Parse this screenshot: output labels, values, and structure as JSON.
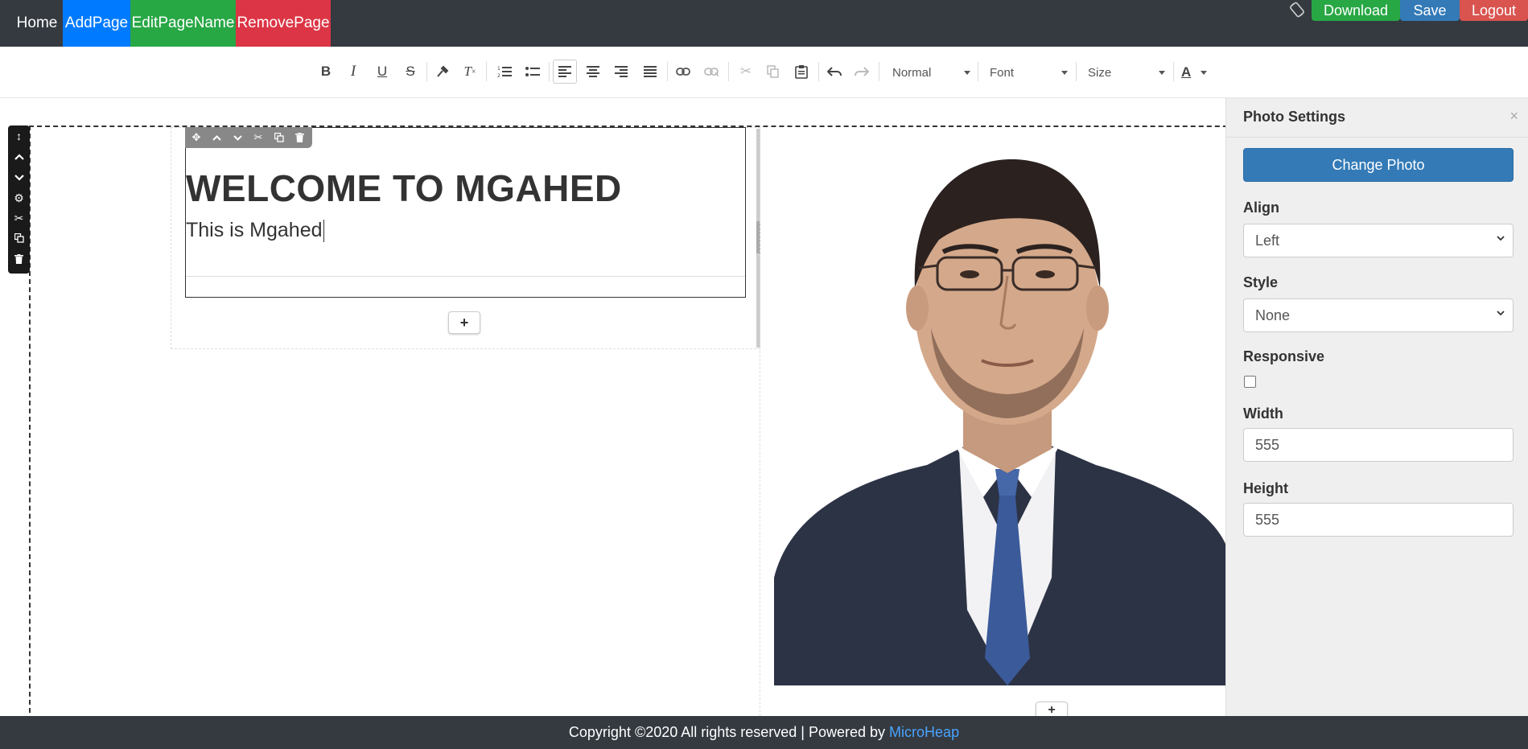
{
  "nav": {
    "home": "Home",
    "add_page": "AddPage",
    "edit_page_name": "EditPageName",
    "remove_page": "RemovePage",
    "download": "Download",
    "save": "Save",
    "logout": "Logout"
  },
  "toolbar": {
    "format_select": "Normal",
    "font_select": "Font",
    "size_select": "Size",
    "text_color": "A",
    "icons": [
      "bold-icon",
      "italic-icon",
      "underline-icon",
      "strike-icon",
      "format-painter-icon",
      "clear-format-icon",
      "ordered-list-icon",
      "bullet-list-icon",
      "align-left-icon",
      "align-center-icon",
      "align-right-icon",
      "justify-icon",
      "link-icon",
      "unlink-icon",
      "cut-icon",
      "copy-icon",
      "paste-icon",
      "undo-icon",
      "redo-icon"
    ]
  },
  "editor": {
    "heading": "WELCOME TO MGAHED",
    "paragraph": "This is Mgahed"
  },
  "panel": {
    "title": "Photo Settings",
    "close": "×",
    "change_photo": "Change Photo",
    "align_label": "Align",
    "align_value": "Left",
    "style_label": "Style",
    "style_value": "None",
    "responsive_label": "Responsive",
    "responsive_checked": false,
    "width_label": "Width",
    "width_value": "555",
    "height_label": "Height",
    "height_value": "555"
  },
  "footer": {
    "text": "Copyright ©2020 All rights reserved | Powered by",
    "brand": "MicroHeap"
  },
  "colors": {
    "nav_bg": "#343a40",
    "primary": "#007bff",
    "success": "#28a745",
    "danger": "#dc3545",
    "btn_blue": "#337ab7",
    "link": "#4aa3ff"
  }
}
